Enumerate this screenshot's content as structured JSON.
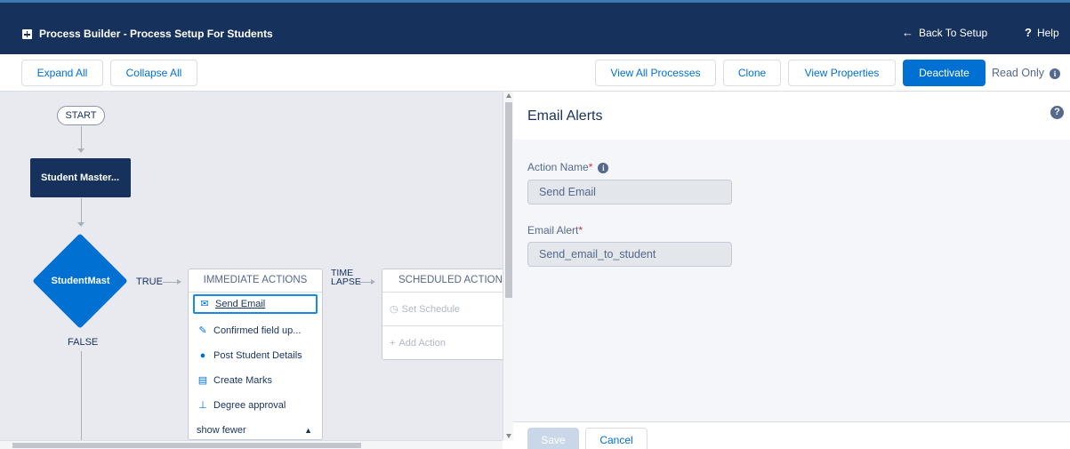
{
  "header": {
    "title": "Process Builder - Process Setup For Students",
    "back_label": "Back To Setup",
    "help_label": "Help"
  },
  "toolbar": {
    "expand_all": "Expand All",
    "collapse_all": "Collapse All",
    "view_all_processes": "View All Processes",
    "clone": "Clone",
    "view_properties": "View Properties",
    "deactivate": "Deactivate",
    "read_only": "Read Only"
  },
  "canvas": {
    "start_label": "START",
    "object_node": "Student Master...",
    "criteria_node": "StudentMast",
    "true_label": "TRUE",
    "false_label": "FALSE",
    "time_lapse_label_1": "TIME",
    "time_lapse_label_2": "LAPSE",
    "immediate": {
      "header": "IMMEDIATE ACTIONS",
      "items": [
        {
          "label": "Send Email",
          "icon": "email-icon"
        },
        {
          "label": "Confirmed field up...",
          "icon": "pencil-icon"
        },
        {
          "label": "Post Student Details",
          "icon": "chat-icon"
        },
        {
          "label": "Create Marks",
          "icon": "record-icon"
        },
        {
          "label": "Degree approval",
          "icon": "approval-icon"
        }
      ],
      "show_fewer": "show fewer"
    },
    "scheduled": {
      "header": "SCHEDULED ACTIONS",
      "set_schedule": "Set Schedule",
      "add_action": "Add Action"
    }
  },
  "panel": {
    "title": "Email Alerts",
    "action_name_label": "Action Name",
    "action_name_value": "Send Email",
    "email_alert_label": "Email Alert",
    "email_alert_value": "Send_email_to_student",
    "save": "Save",
    "cancel": "Cancel"
  },
  "colors": {
    "header_bg": "#16325c",
    "brand": "#0070d2",
    "canvas_bg": "#e8eaef"
  }
}
